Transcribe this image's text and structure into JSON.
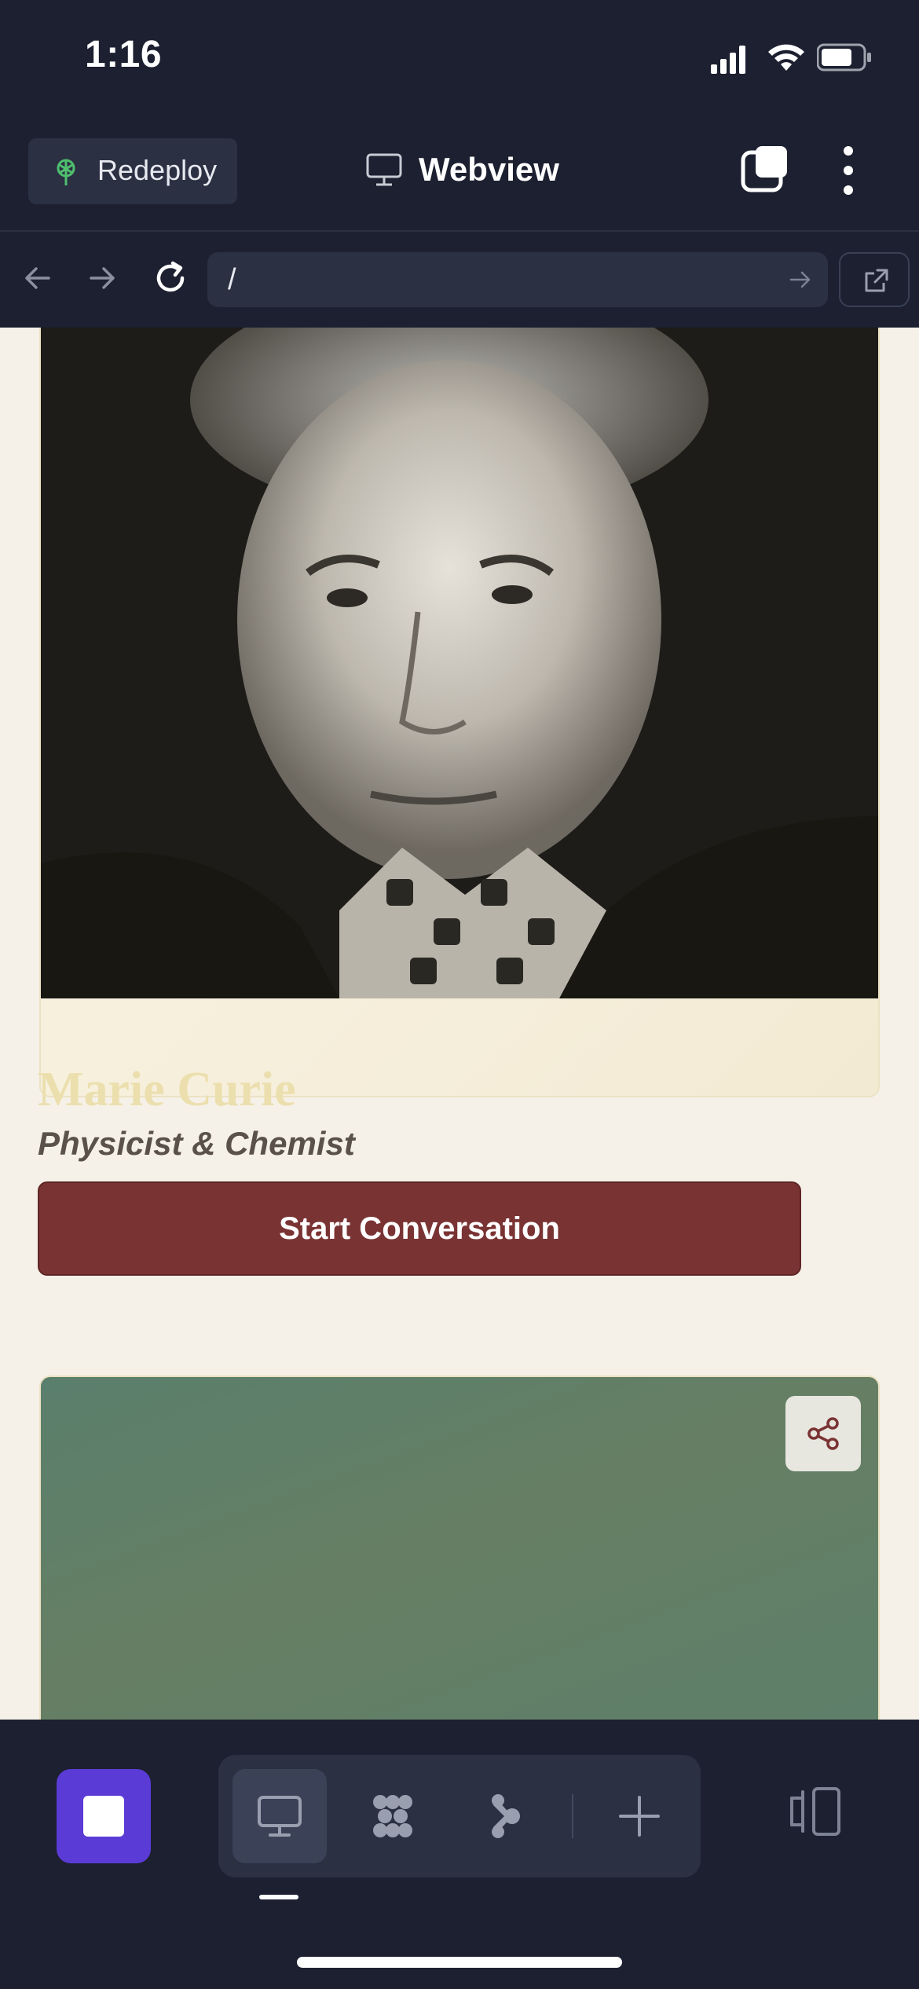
{
  "status_bar": {
    "time": "1:16"
  },
  "header": {
    "redeploy_label": "Redeploy",
    "title": "Webview"
  },
  "urlbar": {
    "url": "/"
  },
  "card": {
    "name": "Marie Curie",
    "role": "Physicist & Chemist",
    "cta_label": "Start Conversation"
  },
  "colors": {
    "accent": "#5b3bd6",
    "cta": "#7a3333",
    "card2_bg": "#5a7f6c",
    "app_bg": "#1c2030"
  }
}
